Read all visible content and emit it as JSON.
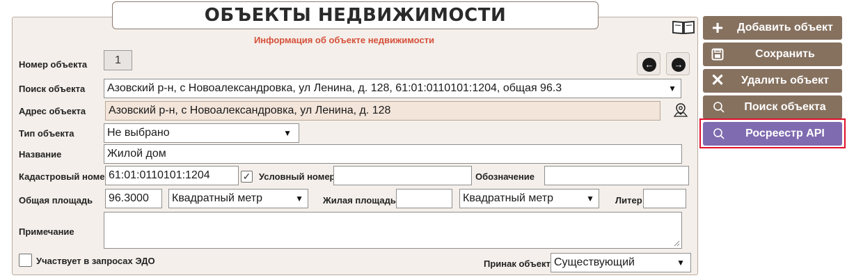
{
  "header": {
    "title": "ОБЪЕКТЫ НЕДВИЖИМОСТИ",
    "subtitle": "Информация об объекте недвижимости",
    "help_icon": "book-icon"
  },
  "form": {
    "object_number": {
      "label": "Номер объекта",
      "value": "1"
    },
    "search": {
      "label": "Поиск объекта",
      "value": "Азовский р-н, с Новоалександровка, ул Ленина, д. 128, 61:01:0110101:1204, общая 96.3"
    },
    "address": {
      "label": "Адрес объекта",
      "value": "Азовский р-н, с Новоалександровка, ул Ленина, д. 128",
      "icon": "map-pin-icon"
    },
    "object_type": {
      "label": "Тип объекта",
      "value": "Не выбрано"
    },
    "name": {
      "label": "Название",
      "value": "Жилой дом"
    },
    "cadastral": {
      "label": "Кадастровый номер",
      "value": "61:01:0110101:1204"
    },
    "conditional": {
      "label": "Условный номер",
      "value": "",
      "checked": true
    },
    "designation": {
      "label": "Обозначение",
      "value": ""
    },
    "total_area": {
      "label": "Общая площадь",
      "value": "96.3000",
      "unit": "Квадратный метр"
    },
    "living_area": {
      "label": "Жилая площадь",
      "value": "",
      "unit": "Квадратный метр"
    },
    "liter": {
      "label": "Литер",
      "value": ""
    },
    "note": {
      "label": "Примечание",
      "value": ""
    },
    "edo": {
      "label": "Участвует в запросах ЭДО",
      "checked": false
    },
    "sign": {
      "label": "Принак объекта",
      "value": "Существующий"
    }
  },
  "nav": {
    "prev_icon": "arrow-left-icon",
    "next_icon": "arrow-right-icon"
  },
  "actions": {
    "add": {
      "label": "Добавить объект",
      "icon": "plus-icon"
    },
    "save": {
      "label": "Сохранить",
      "icon": "save-icon"
    },
    "delete": {
      "label": "Удалить объект",
      "icon": "close-icon"
    },
    "search": {
      "label": "Поиск объекта",
      "icon": "search-icon"
    },
    "rosreestr": {
      "label": "Росреестр API",
      "icon": "search-icon"
    }
  },
  "colors": {
    "accent_brown": "#86715f",
    "accent_purple": "#7f6bb0",
    "subtitle_red": "#d6503a",
    "highlight_red": "#e0102a"
  }
}
